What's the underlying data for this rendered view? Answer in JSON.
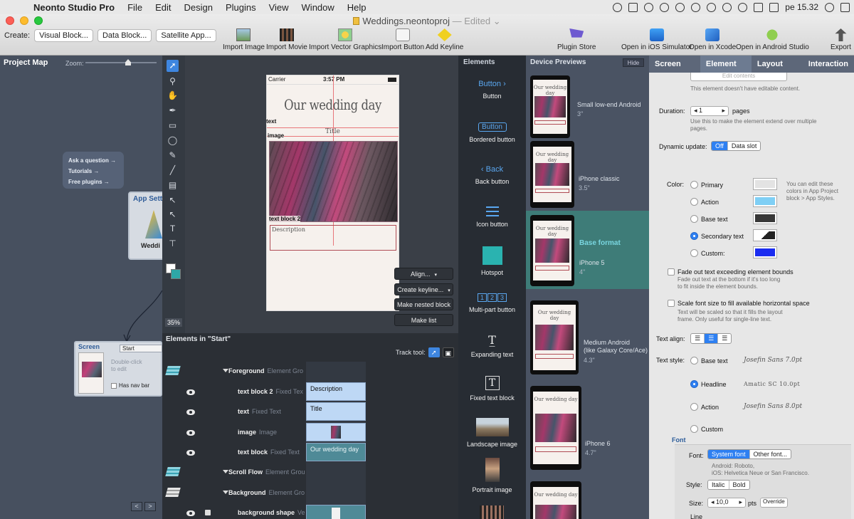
{
  "menubar": {
    "app_name": "Neonto Studio Pro",
    "items": [
      "File",
      "Edit",
      "Design",
      "Plugins",
      "View",
      "Window",
      "Help"
    ],
    "clock": "pe 15.32"
  },
  "window": {
    "title": "Weddings.neontoproj",
    "edited": "— Edited ⌄"
  },
  "toolbar": {
    "create_label": "Create:",
    "create_buttons": [
      "Visual Block...",
      "Data Block...",
      "Satellite App..."
    ],
    "tools": [
      "Import Image",
      "Import Movie",
      "Import Vector Graphics",
      "Import Button",
      "Add Keyline",
      "Plugin Store",
      "Open in iOS Simulator",
      "Open in Xcode",
      "Open in Android Studio",
      "Export"
    ]
  },
  "project_map": {
    "title": "Project Map",
    "zoom_label": "Zoom:",
    "help_links": [
      "Ask a question →",
      "Tutorials →",
      "Free plugins →"
    ],
    "app_settings_title": "App Setti",
    "app_settings_name": "Weddi",
    "screen_card": {
      "title": "Screen",
      "name": "Start",
      "hint_line1": "Double-click",
      "hint_line2": "to edit",
      "nav_label": "Has nav bar"
    },
    "nav_prev": "<",
    "nav_next": ">"
  },
  "canvas": {
    "zoom_percent": "35%",
    "phone": {
      "carrier": "Carrier",
      "time": "3:57 PM",
      "heading": "Our wedding day",
      "title_text": "Title",
      "description_text": "Description"
    },
    "labels": {
      "text": "text",
      "image": "image",
      "text_block_2": "text block 2"
    },
    "buttons": [
      "Align...",
      "Create keyline...",
      "Make nested block",
      "Make list"
    ]
  },
  "elements_list": {
    "title": "Elements in \"Start\"",
    "track_tool_label": "Track tool:",
    "rows": [
      {
        "name": "Foreground",
        "kind": "Element Gro",
        "chip": ""
      },
      {
        "name": "text block 2",
        "kind": "Fixed Tex",
        "chip": "Description"
      },
      {
        "name": "text",
        "kind": "Fixed Text",
        "chip": "Title"
      },
      {
        "name": "image",
        "kind": "Image",
        "chip": ""
      },
      {
        "name": "text block",
        "kind": "Fixed Text",
        "chip": "Our wedding day"
      },
      {
        "name": "Scroll Flow",
        "kind": "Element Grou",
        "chip": ""
      },
      {
        "name": "Background",
        "kind": "Element Gro",
        "chip": ""
      },
      {
        "name": "background shape",
        "kind": "Ve",
        "chip": ""
      }
    ]
  },
  "palette": {
    "title": "Elements",
    "items": [
      "Button",
      "Bordered button",
      "Back button",
      "Icon button",
      "Hotspot",
      "Multi-part button",
      "Expanding text",
      "Fixed text block",
      "Landscape image",
      "Portrait image"
    ],
    "button_sample": "Button",
    "bordered_sample": "Button",
    "back_sample": "Back",
    "multipart_sample": [
      "1",
      "2",
      "3"
    ]
  },
  "device_previews": {
    "title": "Device Previews",
    "hide_label": "Hide",
    "screen_heading": "Our wedding day",
    "devices": [
      {
        "name": "Small low-end Android",
        "size": "3\"",
        "base_format": ""
      },
      {
        "name": "iPhone classic",
        "size": "3.5\"",
        "base_format": ""
      },
      {
        "name": "iPhone 5",
        "size": "4\"",
        "base_format": "Base format"
      },
      {
        "name": "Medium Android\n(like Galaxy Core/Ace)",
        "size": "4.3\"",
        "base_format": ""
      },
      {
        "name": "iPhone 6",
        "size": "4.7\"",
        "base_format": ""
      }
    ]
  },
  "inspector": {
    "tabs": [
      "Screen",
      "Element",
      "Layout",
      "Interaction"
    ],
    "active_tab": "Element",
    "edit_contents_label": "Edit contents",
    "no_content_note": "This element doesn't have editable content.",
    "duration_label": "Duration:",
    "duration_value": "1",
    "duration_unit": "pages",
    "duration_note": "Use this to make the element extend over multiple pages.",
    "dynamic_label": "Dynamic update:",
    "dynamic_options": [
      "Off",
      "Data slot"
    ],
    "color_label": "Color:",
    "color_options": [
      {
        "label": "Primary",
        "color": "#e3e3e3"
      },
      {
        "label": "Action",
        "color": "#7fcff5"
      },
      {
        "label": "Base text",
        "color": "#383838"
      },
      {
        "label": "Secondary text",
        "color": "#222222"
      },
      {
        "label": "Custom:",
        "color": "#1a2cf0"
      }
    ],
    "color_selected": "Secondary text",
    "color_note": "You can edit these colors in App Project block > App Styles.",
    "fade_label": "Fade out text exceeding element bounds",
    "fade_note": "Fade out text at the bottom if it's too long to fit inside the element bounds.",
    "scale_label": "Scale font size to fill available horizontal space",
    "scale_note": "Text will be scaled so that it fills the layout frame. Only useful for single-line text.",
    "align_label": "Text align:",
    "style_label": "Text style:",
    "style_options": [
      {
        "label": "Base text",
        "sample": "Josefin Sans 7.0pt"
      },
      {
        "label": "Headline",
        "sample": "Amatic SC 10.0pt"
      },
      {
        "label": "Action",
        "sample": "Josefin Sans 8.0pt"
      },
      {
        "label": "Custom",
        "sample": ""
      }
    ],
    "style_selected": "Headline",
    "font_section": "Font",
    "font_label": "Font:",
    "font_options": [
      "System font",
      "Other font..."
    ],
    "font_note_line1": "Android: Roboto,",
    "font_note_line2": "iOS: Helvetica Neue or San Francisco.",
    "fstyle_label": "Style:",
    "fstyle_options": [
      "Italic",
      "Bold"
    ],
    "size_label": "Size:",
    "size_value": "10,0",
    "size_unit": "pts",
    "override_label": "Override",
    "line_label": "Line"
  }
}
